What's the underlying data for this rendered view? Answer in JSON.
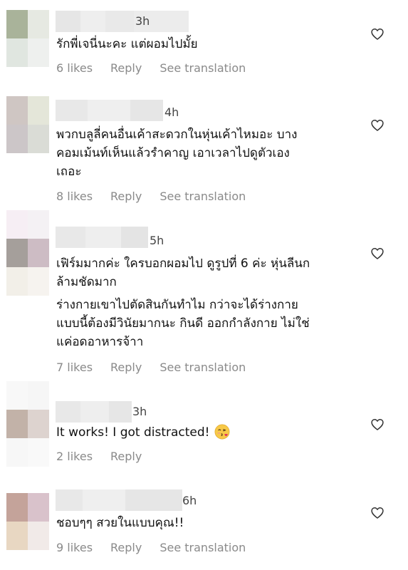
{
  "comments": [
    {
      "time": "3h",
      "text": [
        "รักพี่เจนี่นะคะ แต่ผอมไปมั้ย"
      ],
      "likes": "6 likes",
      "reply": "Reply",
      "translate": "See translation"
    },
    {
      "time": "4h",
      "text": [
        "พวกบลูลี่คนอื่นเค้าสะดวกในหุ่นเค้าไหมอะ บาง",
        "คอมเม้นท์เห็นแล้วรำคาญ เอาเวลาไปดูตัวเอง",
        "เถอะ"
      ],
      "likes": "8 likes",
      "reply": "Reply",
      "translate": "See translation"
    },
    {
      "time": "5h",
      "text": [
        "เฟิร์มมากค่ะ ใครบอกผอมไป ดูรูปที่ 6 ค่ะ หุ่นลีนก",
        "ล้ามชัดมาก"
      ],
      "text2": [
        "ร่างกายเขาไปตัดสินกันทำไม กว่าจะได้ร่างกาย",
        "แบบนี้ต้องมีวินัยมากนะ กินดี ออกกำลังกาย ไม่ใช่",
        "แค่อดอาหารจ้าา"
      ],
      "likes": "7 likes",
      "reply": "Reply",
      "translate": "See translation"
    },
    {
      "time": "3h",
      "text": [
        "It works! I got distracted!"
      ],
      "emoji": "face-blowing-kiss",
      "likes": "2 likes",
      "reply": "Reply"
    },
    {
      "time": "6h",
      "text": [
        "ชอบๆๆ สวยในแบบคุณ!!"
      ],
      "likes": "9 likes",
      "reply": "Reply",
      "translate": "See translation"
    }
  ],
  "icons": {
    "heart": "heart-outline-icon"
  },
  "colors": {
    "text": "#111111",
    "meta": "#8a8a8a",
    "time": "#444444"
  }
}
